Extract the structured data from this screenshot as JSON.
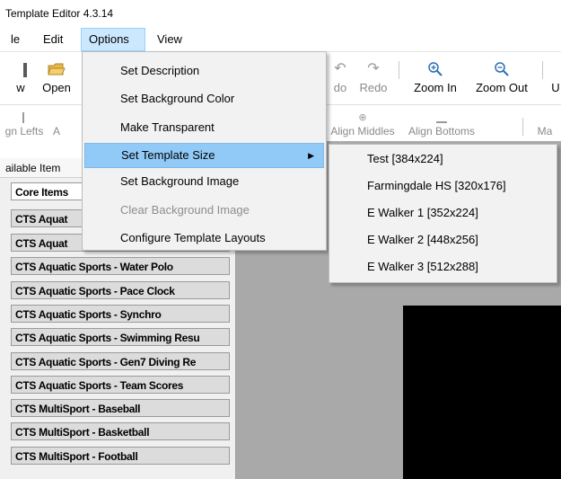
{
  "window": {
    "title": "Template Editor 4.3.14"
  },
  "menubar": {
    "items": [
      "le",
      "Edit",
      "Options",
      "View"
    ]
  },
  "toolbar": {
    "new_label": "w",
    "open_label": "Open",
    "undo_label": "do",
    "redo_label": "Redo",
    "zoom_in_label": "Zoom In",
    "zoom_out_label": "Zoom Out",
    "cut_label": "U"
  },
  "alignbar": {
    "align_lefts_label": "gn Lefts",
    "a_label": "A",
    "align_middles_label": "Align Middles",
    "align_bottoms_label": "Align Bottoms",
    "ma_label": "Ma"
  },
  "left_panel": {
    "header": "ailable Item",
    "items": [
      "Core Items",
      "CTS Aquat",
      "CTS Aquat",
      "CTS Aquatic Sports - Water Polo",
      "CTS Aquatic Sports - Pace Clock",
      "CTS Aquatic Sports - Synchro",
      "CTS Aquatic Sports - Swimming Resu",
      "CTS Aquatic Sports - Gen7 Diving Re",
      "CTS Aquatic Sports - Team Scores",
      "CTS MultiSport - Baseball",
      "CTS MultiSport - Basketball",
      "CTS MultiSport - Football"
    ]
  },
  "options_menu": {
    "items": [
      "Set Description",
      "Set Background Color",
      "Make Transparent",
      "Set Template Size",
      "Set Background Image",
      "Clear Background Image",
      "Configure Template Layouts"
    ]
  },
  "template_size_submenu": {
    "items": [
      "Test [384x224]",
      "Farmingdale HS [320x176]",
      "E Walker 1 [352x224]",
      "E Walker 2 [448x256]",
      "E Walker 3 [512x288]"
    ]
  },
  "colors": {
    "menu_highlight": "#91c9f7",
    "menubar_active": "#cce8ff",
    "canvas_background": "#a9a9a9",
    "panel_background": "#f0f0f0"
  }
}
